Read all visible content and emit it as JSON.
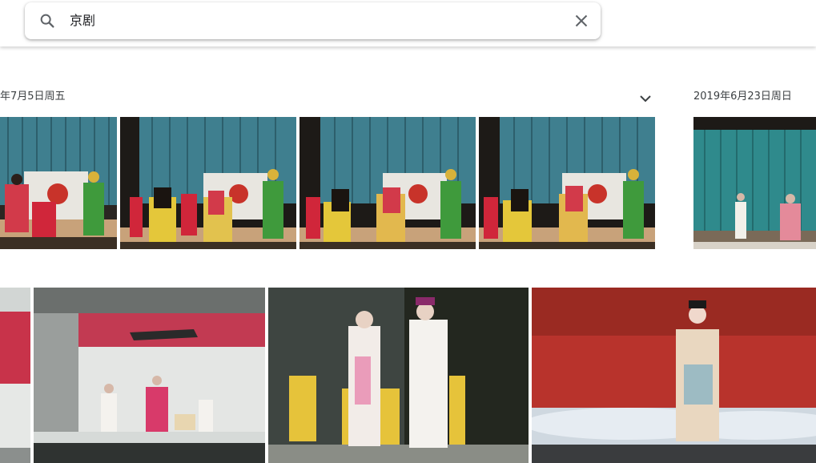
{
  "search": {
    "query": "京剧",
    "search_icon": "search-icon",
    "clear_icon": "close-icon"
  },
  "groups": [
    {
      "date": "年7月5日周五",
      "expand_icon": "chevron-down-icon"
    },
    {
      "date": "2019年6月23日周日"
    }
  ],
  "colors": {
    "stage_curtain": "#3f7f8f",
    "stage_floor": "#c8a27a",
    "red_backdrop": "#b8332c",
    "dark_stage": "#2f3531"
  }
}
